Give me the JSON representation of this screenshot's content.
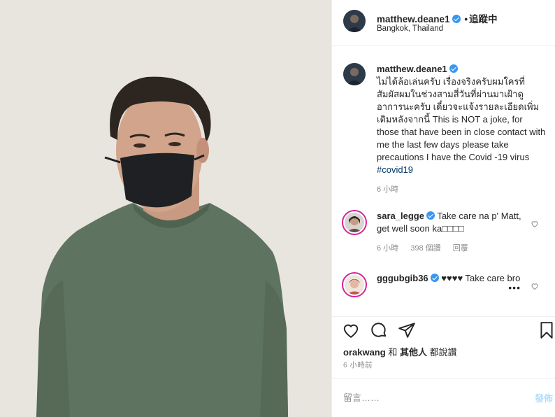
{
  "post": {
    "author": "matthew.deane1",
    "follow_separator": "•",
    "follow_label": "追蹤中",
    "location": "Bangkok, Thailand"
  },
  "caption": {
    "username": "matthew.deane1",
    "text": "ไม่ได้ล้อเล่นครับ เรื่องจริงครับผมใครที่สัมผัสผมในช่วงสามสี่วันที่ผ่านมาเฝ้าดูอาการนะครับ เดี๋ยวจะแจ้งรายละเอียดเพิ่มเติมหลังจากนี้ This is NOT a joke, for those that have been in close contact with me the last few days please take precautions I have the Covid -19 virus",
    "hashtag": "#covid19",
    "time": "6 小時"
  },
  "comments": [
    {
      "username": "sara_legge",
      "text": "Take care na p' Matt, get well soon ka□□□□",
      "time": "6 小時",
      "likes": "398 個讚",
      "reply": "回覆"
    },
    {
      "username": "gggubgib36",
      "text": "♥♥♥♥ Take care bro",
      "more": "•••"
    }
  ],
  "actions": {
    "like_icon": "heart-icon",
    "comment_icon": "comment-icon",
    "share_icon": "share-icon",
    "save_icon": "bookmark-icon"
  },
  "likes": {
    "first": "orakwang",
    "and": "和",
    "others": "其他人",
    "suffix": "都說讚"
  },
  "timestamp": "6 小時前",
  "add_comment": {
    "placeholder": "留言……",
    "post_label": "發佈"
  },
  "colors": {
    "link": "#00376b",
    "verified": "#3897f0",
    "muted": "#8e8e8e",
    "post_disabled": "#b2dffc"
  }
}
